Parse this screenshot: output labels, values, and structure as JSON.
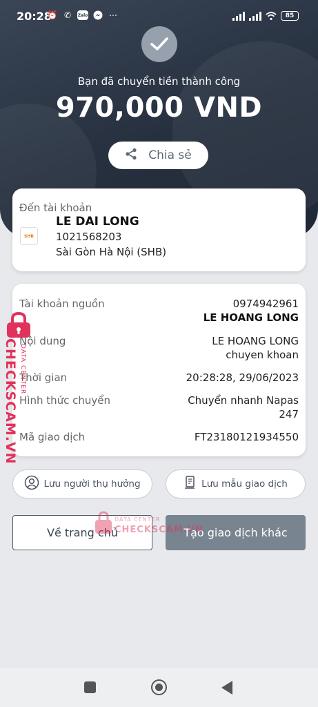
{
  "status_bar": {
    "time": "20:28",
    "battery": "85",
    "zalo_label": "Zalo"
  },
  "hero": {
    "success_text": "Bạn đã chuyển tiền thành công",
    "amount": "970,000 VND",
    "share_label": "Chia sẻ"
  },
  "recipient": {
    "label": "Đến tài khoản",
    "bank_logo_text": "SHB",
    "name": "LE DAI LONG",
    "account": "1021568203",
    "bank": "Sài Gòn Hà Nội (SHB)"
  },
  "details": {
    "rows": [
      {
        "label": "Tài khoản nguồn",
        "value": "0974942961",
        "value2": "LE HOANG LONG"
      },
      {
        "label": "Nội dung",
        "value": "LE HOANG LONG",
        "value2": "chuyen khoan"
      },
      {
        "label": "Thời gian",
        "value": "20:28:28, 29/06/2023"
      },
      {
        "label": "Hình thức chuyển",
        "value": "Chuyển nhanh Napas",
        "value2": "247"
      },
      {
        "label": "Mã giao dịch",
        "value": "FT23180121934550"
      }
    ]
  },
  "actions": {
    "save_beneficiary": "Lưu người thụ hưởng",
    "save_template": "Lưu mẫu giao dịch",
    "home": "Về trang chủ",
    "new_transaction": "Tạo giao dịch khác"
  },
  "watermark": {
    "text": "CHECKSCAM.VN",
    "sub": "DATA CENTER"
  },
  "colors": {
    "hero_bg": "#2b3442",
    "watermark": "#e0325a",
    "primary_button": "#78848f"
  }
}
